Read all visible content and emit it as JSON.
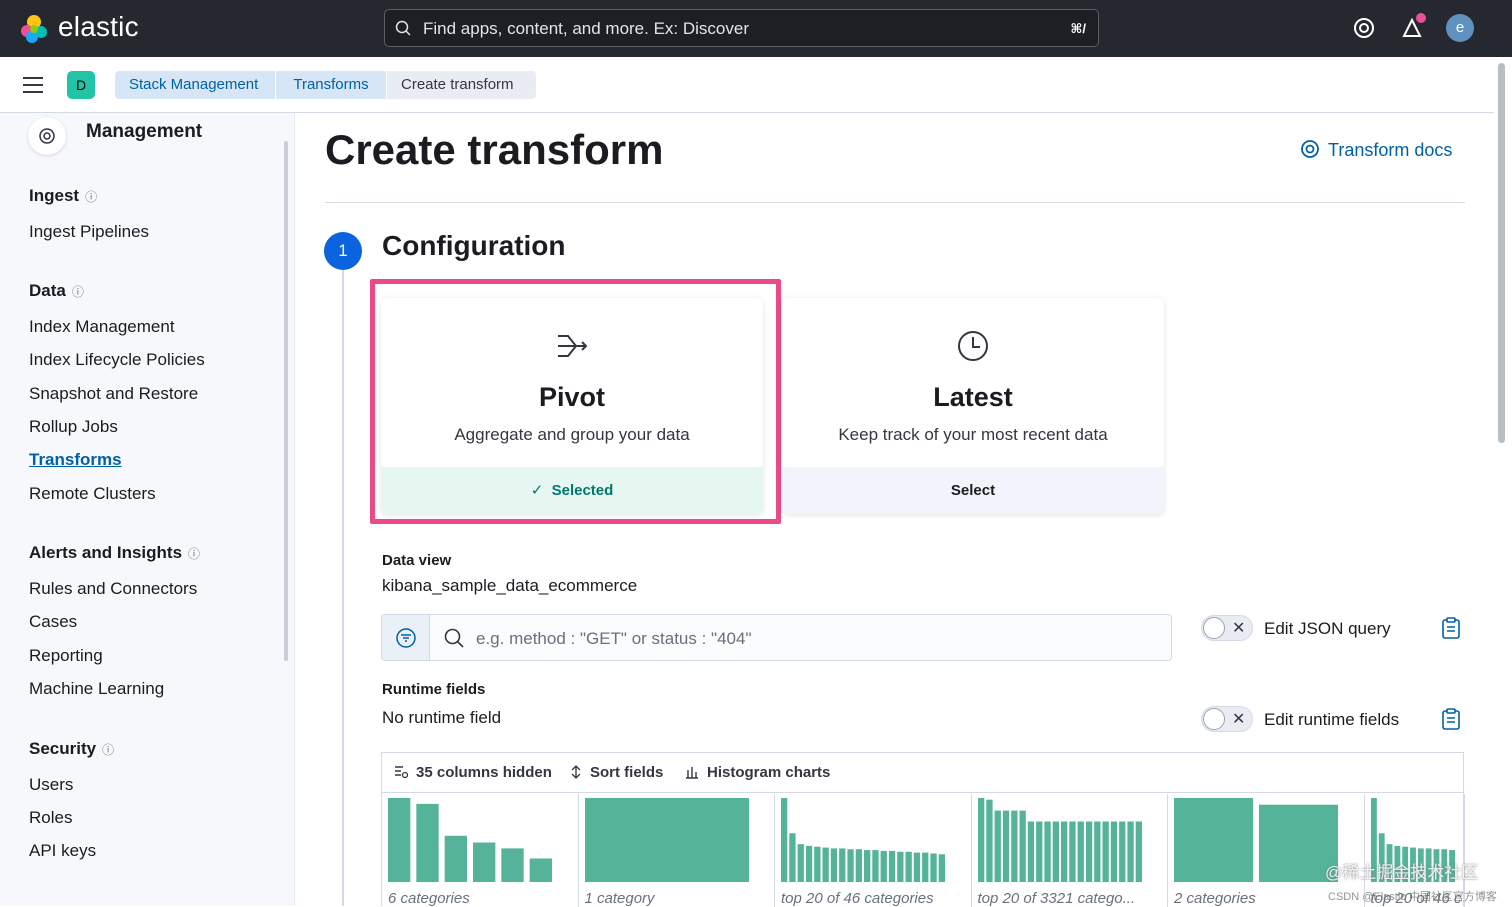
{
  "header": {
    "brand": "elastic",
    "search_placeholder": "Find apps, content, and more. Ex: Discover",
    "search_shortcut": "⌘/",
    "avatar_initial": "e"
  },
  "breadcrumbs": {
    "space_initial": "D",
    "items": [
      "Stack Management",
      "Transforms",
      "Create transform"
    ]
  },
  "sidebar": {
    "title": "Management",
    "sections": [
      {
        "title": "Ingest",
        "items": [
          "Ingest Pipelines"
        ]
      },
      {
        "title": "Data",
        "items": [
          "Index Management",
          "Index Lifecycle Policies",
          "Snapshot and Restore",
          "Rollup Jobs",
          "Transforms",
          "Remote Clusters"
        ]
      },
      {
        "title": "Alerts and Insights",
        "items": [
          "Rules and Connectors",
          "Cases",
          "Reporting",
          "Machine Learning"
        ]
      },
      {
        "title": "Security",
        "items": [
          "Users",
          "Roles",
          "API keys"
        ]
      }
    ],
    "active_item": "Transforms"
  },
  "main": {
    "title": "Create transform",
    "docs_link": "Transform docs",
    "step_number": "1",
    "step_title": "Configuration",
    "cards": {
      "pivot": {
        "title": "Pivot",
        "description": "Aggregate and group your data",
        "footer": "Selected"
      },
      "latest": {
        "title": "Latest",
        "description": "Keep track of your most recent data",
        "footer": "Select"
      }
    },
    "data_view_label": "Data view",
    "data_view_value": "kibana_sample_data_ecommerce",
    "query_placeholder": "e.g. method : \"GET\" or status : \"404\"",
    "edit_json_label": "Edit JSON query",
    "runtime_label": "Runtime fields",
    "runtime_value": "No runtime field",
    "edit_runtime_label": "Edit runtime fields",
    "grid_toolbar": {
      "columns": "35 columns hidden",
      "sort": "Sort fields",
      "histogram": "Histogram charts"
    },
    "histograms": [
      {
        "caption": "6 categories",
        "values": [
          1.0,
          0.93,
          0.55,
          0.47,
          0.4,
          0.28
        ]
      },
      {
        "caption": "1 category",
        "values": [
          1.0
        ]
      },
      {
        "caption": "top 20 of 46 categories",
        "values": [
          1.0,
          0.58,
          0.45,
          0.43,
          0.42,
          0.41,
          0.4,
          0.4,
          0.39,
          0.39,
          0.38,
          0.38,
          0.37,
          0.37,
          0.36,
          0.36,
          0.35,
          0.35,
          0.34,
          0.33
        ]
      },
      {
        "caption": "top 20 of 3321 catego...",
        "values": [
          1.0,
          0.98,
          0.85,
          0.85,
          0.85,
          0.85,
          0.72,
          0.72,
          0.72,
          0.72,
          0.72,
          0.72,
          0.72,
          0.72,
          0.72,
          0.72,
          0.72,
          0.72,
          0.72,
          0.72
        ]
      },
      {
        "caption": "2 categories",
        "values": [
          1.0,
          0.92
        ]
      },
      {
        "caption": "top 20 of 46 c",
        "values": [
          1.0,
          0.58,
          0.45,
          0.43,
          0.42,
          0.41,
          0.4,
          0.4,
          0.39,
          0.39,
          0.38
        ]
      }
    ],
    "bar_color": "#54b399"
  },
  "watermark": {
    "line1": "@稀土掘金技术社区",
    "line2": "CSDN @Elastic 中国社区官方博客"
  }
}
